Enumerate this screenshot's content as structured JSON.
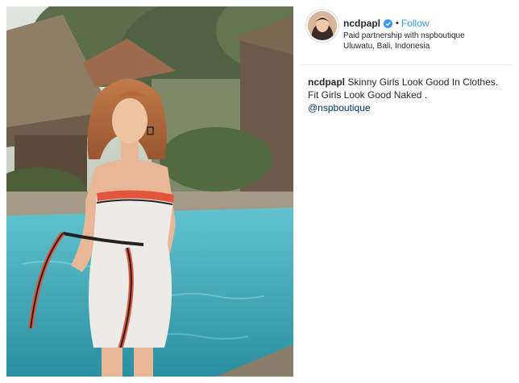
{
  "post": {
    "username": "ncdpapl",
    "follow_label": "Follow",
    "dot": "•",
    "partnership": "Paid partnership with nspboutique",
    "location": "Uluwatu, Bali, Indonesia",
    "caption_user": "ncdpapl",
    "caption_text": "Skinny Girls Look Good In Clothes. Fit Girls Look Good Naked .",
    "mention": "@nspboutique"
  },
  "colors": {
    "link": "#3897f0",
    "mention": "#003569",
    "text": "#262626",
    "pool": "#3aa6b6",
    "dress": "#ecebe8",
    "dress_stripe": "#e2553a"
  },
  "icons": {
    "verified": "verified-badge-icon"
  }
}
